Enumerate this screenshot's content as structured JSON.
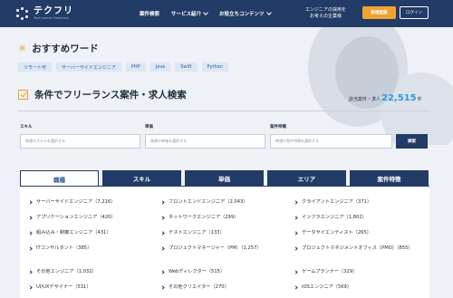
{
  "header": {
    "logo_name": "テクフリ",
    "logo_sub": "Tech Lancer Freelance",
    "nav": [
      "案件検索",
      "サービス紹介",
      "お役立ちコンテンツ"
    ],
    "corporate_line1": "エンジニアの採用を",
    "corporate_line2": "お考えの企業様",
    "favorite_label": "お気に入り",
    "register_label": "新規登録",
    "login_label": "ログイン"
  },
  "recommend": {
    "title": "おすすめワード",
    "tags": [
      "リモート可",
      "サーバーサイドエンジニア",
      "PHP",
      "Java",
      "Swift",
      "Python"
    ]
  },
  "search": {
    "title": "条件でフリーランス案件・求人検索",
    "count_label": "該当案件・求人",
    "count_value": "22,515",
    "count_unit": "件",
    "fields": [
      {
        "label": "スキル",
        "placeholder": "希望のスキルを選択する"
      },
      {
        "label": "単価",
        "placeholder": "希望の単価を選択する"
      },
      {
        "label": "案件特徴",
        "placeholder": "希望の案件特徴を選択する"
      }
    ],
    "button_label": "検索"
  },
  "tabs": [
    {
      "label": "職種",
      "active": true
    },
    {
      "label": "スキル",
      "active": false
    },
    {
      "label": "単価",
      "active": false
    },
    {
      "label": "エリア",
      "active": false
    },
    {
      "label": "案件特徴",
      "active": false
    }
  ],
  "jobs": [
    [
      "サーバーサイドエンジニア（7,216）",
      "フロントエンドエンジニア（2,043）",
      "クライアントエンジニア（371）"
    ],
    [
      "アプリケーションエンジニア（420）",
      "ネットワークエンジニア（299）",
      "インフラエンジニア（1,802）"
    ],
    [
      "組み込み・制御エンジニア（431）",
      "テストエンジニア（133）",
      "データサイエンティスト（265）"
    ],
    [
      "ITコンサルタント（385）",
      "プロジェクトマネージャー（PM）（1,257）",
      "プロジェクトマネジメントオフィス（PMO）（855）"
    ],
    [
      "その他エンジニア（1,032）",
      "Webディレクター（515）",
      "ゲームプランナー（329）"
    ],
    [
      "UI/UXデザイナー（531）",
      "その他クリエイター（270）",
      "iOSエンジニア（569）"
    ]
  ]
}
